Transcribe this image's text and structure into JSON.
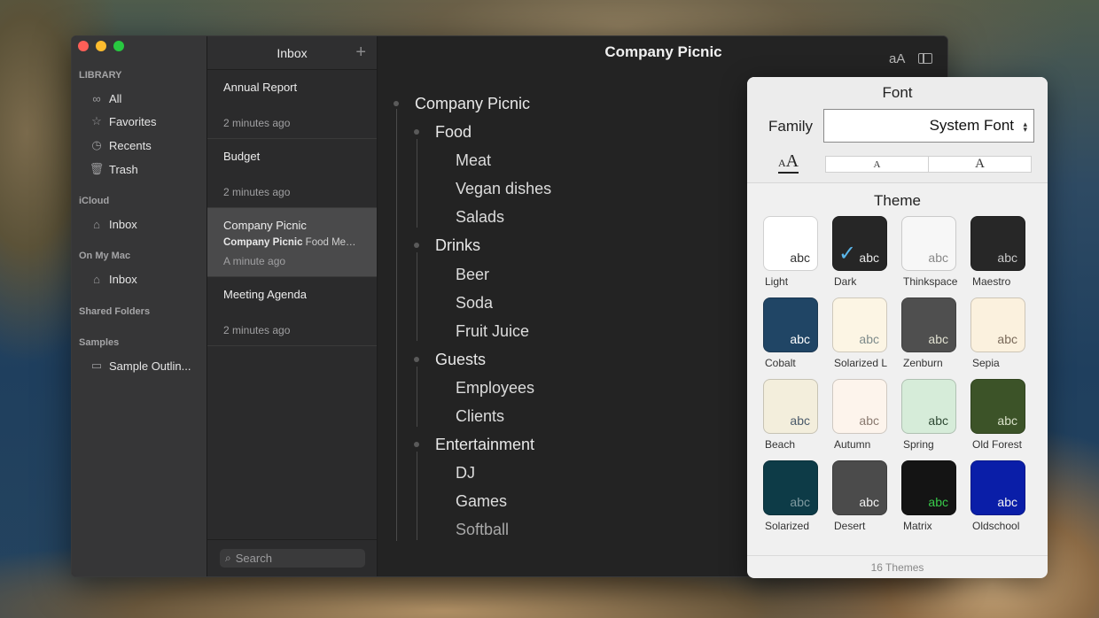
{
  "window": {
    "title": "Company Picnic"
  },
  "sidebar": {
    "sections": {
      "library": "LIBRARY",
      "icloud": "iCloud",
      "on_my_mac": "On My Mac",
      "shared": "Shared Folders",
      "samples": "Samples"
    },
    "library_items": [
      {
        "label": "All",
        "icon": "infinity-icon"
      },
      {
        "label": "Favorites",
        "icon": "star-icon"
      },
      {
        "label": "Recents",
        "icon": "clock-icon"
      },
      {
        "label": "Trash",
        "icon": "trash-icon"
      }
    ],
    "icloud_inbox": "Inbox",
    "mac_inbox": "Inbox",
    "sample_folder": "Sample Outlin..."
  },
  "doc_list": {
    "header": "Inbox",
    "add_icon": "plus-icon",
    "docs": [
      {
        "title": "Annual Report",
        "preview_bold": "",
        "preview": "",
        "time": "2 minutes ago"
      },
      {
        "title": "Budget",
        "preview_bold": "",
        "preview": "",
        "time": "2 minutes ago"
      },
      {
        "title": "Company Picnic",
        "preview_bold": "Company Picnic",
        "preview": " Food Meat...",
        "time": "A minute ago"
      },
      {
        "title": "Meeting Agenda",
        "preview_bold": "",
        "preview": "",
        "time": "2 minutes ago"
      }
    ],
    "search_placeholder": "Search"
  },
  "editor": {
    "font_button": "aA",
    "outline": {
      "root": "Company Picnic",
      "groups": [
        {
          "label": "Food",
          "children": [
            "Meat",
            "Vegan dishes",
            "Salads"
          ]
        },
        {
          "label": "Drinks",
          "children": [
            "Beer",
            "Soda",
            "Fruit Juice"
          ]
        },
        {
          "label": "Guests",
          "children": [
            "Employees",
            "Clients"
          ]
        },
        {
          "label": "Entertainment",
          "children": [
            "DJ",
            "Games",
            "Softball"
          ]
        }
      ]
    }
  },
  "font_popover": {
    "heading": "Font",
    "family_label": "Family",
    "family_value": "System Font",
    "theme_heading": "Theme",
    "footer": "16 Themes",
    "selected_theme": "Dark",
    "themes": [
      {
        "name": "Light",
        "bg": "#ffffff",
        "fg": "#333333"
      },
      {
        "name": "Dark",
        "bg": "#262626",
        "fg": "#e8e8e8"
      },
      {
        "name": "Thinkspace",
        "bg": "#f7f7f7",
        "fg": "#888888"
      },
      {
        "name": "Maestro",
        "bg": "#272727",
        "fg": "#c8c8c8"
      },
      {
        "name": "Cobalt",
        "bg": "#204565",
        "fg": "#ffffff"
      },
      {
        "name": "Solarized L",
        "bg": "#fcf5e4",
        "fg": "#7e8b8b"
      },
      {
        "name": "Zenburn",
        "bg": "#4f4f4f",
        "fg": "#e0e0d0"
      },
      {
        "name": "Sepia",
        "bg": "#fbf1de",
        "fg": "#7a6a5a"
      },
      {
        "name": "Beach",
        "bg": "#f3eedc",
        "fg": "#4a5a6a"
      },
      {
        "name": "Autumn",
        "bg": "#fdf4ec",
        "fg": "#8a7a70"
      },
      {
        "name": "Spring",
        "bg": "#d6ecd9",
        "fg": "#2f4a34"
      },
      {
        "name": "Old Forest",
        "bg": "#3c5328",
        "fg": "#d8e0c8"
      },
      {
        "name": "Solarized",
        "bg": "#0d3b47",
        "fg": "#7f9aa0"
      },
      {
        "name": "Desert",
        "bg": "#4b4b4b",
        "fg": "#f2f2f2"
      },
      {
        "name": "Matrix",
        "bg": "#141414",
        "fg": "#38c94a"
      },
      {
        "name": "Oldschool",
        "bg": "#0a1ea8",
        "fg": "#f2f2f2"
      }
    ]
  }
}
